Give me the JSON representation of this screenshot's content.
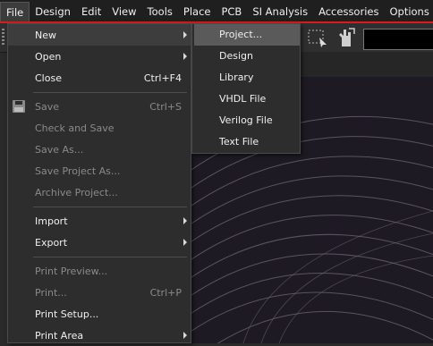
{
  "menubar": {
    "items": [
      {
        "label": "File"
      },
      {
        "label": "Design"
      },
      {
        "label": "Edit"
      },
      {
        "label": "View"
      },
      {
        "label": "Tools"
      },
      {
        "label": "Place"
      },
      {
        "label": "PCB"
      },
      {
        "label": "SI Analysis"
      },
      {
        "label": "Accessories"
      },
      {
        "label": "Options"
      }
    ]
  },
  "file_menu": {
    "items": [
      {
        "label": "New",
        "shortcut": "",
        "enabled": true,
        "submenu": true
      },
      {
        "label": "Open",
        "shortcut": "",
        "enabled": true,
        "submenu": true
      },
      {
        "label": "Close",
        "shortcut": "Ctrl+F4",
        "enabled": true,
        "submenu": false
      },
      {
        "label": "Save",
        "shortcut": "Ctrl+S",
        "enabled": false,
        "submenu": false,
        "icon": "save-icon"
      },
      {
        "label": "Check and Save",
        "shortcut": "",
        "enabled": false,
        "submenu": false
      },
      {
        "label": "Save As...",
        "shortcut": "",
        "enabled": false,
        "submenu": false
      },
      {
        "label": "Save Project As...",
        "shortcut": "",
        "enabled": false,
        "submenu": false
      },
      {
        "label": "Archive Project...",
        "shortcut": "",
        "enabled": false,
        "submenu": false
      },
      {
        "label": "Import",
        "shortcut": "",
        "enabled": true,
        "submenu": true
      },
      {
        "label": "Export",
        "shortcut": "",
        "enabled": true,
        "submenu": true
      },
      {
        "label": "Print Preview...",
        "shortcut": "",
        "enabled": false,
        "submenu": false
      },
      {
        "label": "Print...",
        "shortcut": "Ctrl+P",
        "enabled": false,
        "submenu": false
      },
      {
        "label": "Print Setup...",
        "shortcut": "",
        "enabled": true,
        "submenu": false
      },
      {
        "label": "Print Area",
        "shortcut": "",
        "enabled": true,
        "submenu": true
      }
    ]
  },
  "new_submenu": {
    "items": [
      {
        "label": "Project..."
      },
      {
        "label": "Design"
      },
      {
        "label": "Library"
      },
      {
        "label": "VHDL File"
      },
      {
        "label": "Verilog File"
      },
      {
        "label": "Text File"
      }
    ]
  },
  "colors": {
    "accent": "#d61c1c",
    "menu_bg": "#2d2d2d",
    "canvas_bg": "#1e1a23"
  }
}
